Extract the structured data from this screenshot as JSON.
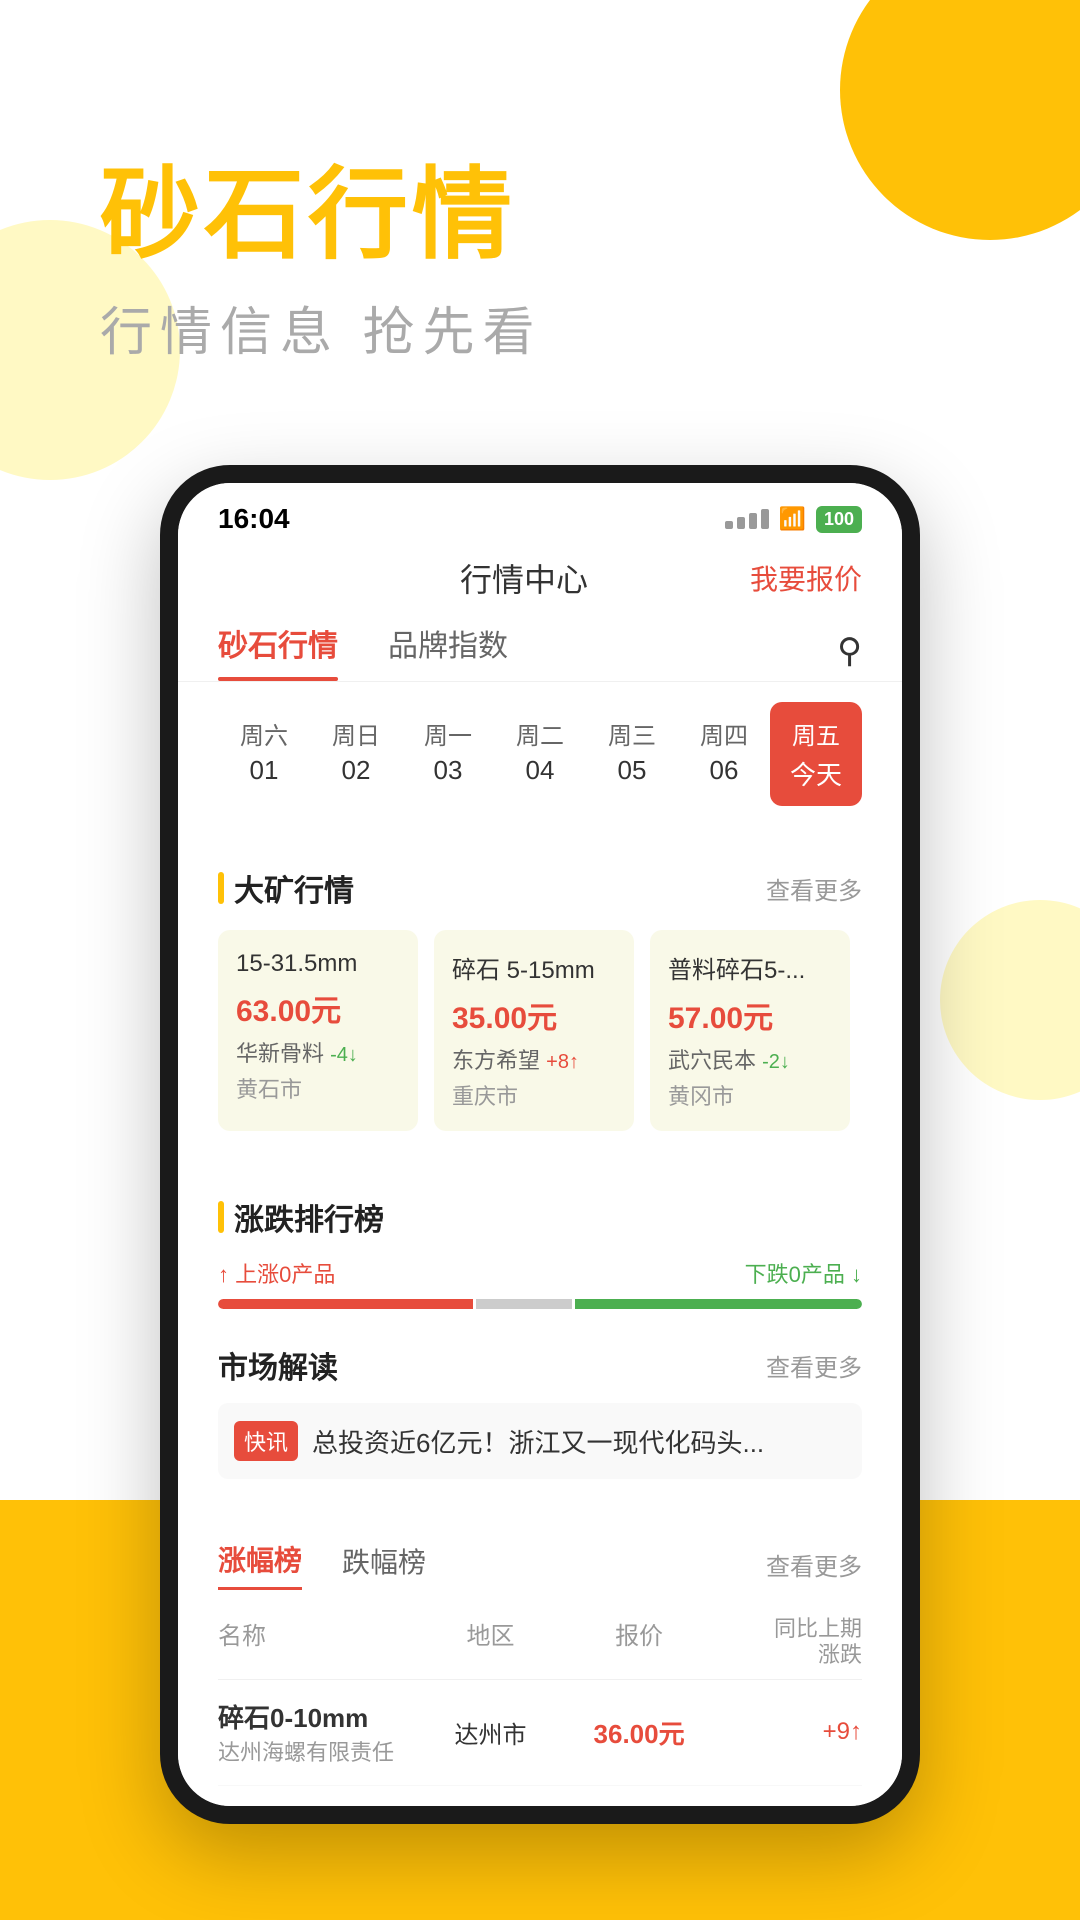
{
  "app": {
    "title": "砂石行情",
    "subtitle": "行情信息  抢先看"
  },
  "status_bar": {
    "time": "16:04",
    "battery": "100"
  },
  "header": {
    "title": "行情中心",
    "action": "我要报价"
  },
  "tabs": [
    {
      "label": "砂石行情",
      "active": true
    },
    {
      "label": "品牌指数",
      "active": false
    }
  ],
  "days": [
    {
      "name": "周六",
      "num": "01",
      "active": false
    },
    {
      "name": "周日",
      "num": "02",
      "active": false
    },
    {
      "name": "周一",
      "num": "03",
      "active": false
    },
    {
      "name": "周二",
      "num": "04",
      "active": false
    },
    {
      "name": "周三",
      "num": "05",
      "active": false
    },
    {
      "name": "周四",
      "num": "06",
      "active": false
    },
    {
      "name": "周五",
      "num": "今天",
      "active": true
    }
  ],
  "market_section": {
    "title": "大矿行情",
    "more": "查看更多",
    "cards": [
      {
        "product": "15-31.5mm",
        "price": "63.00元",
        "company": "华新骨料",
        "change": "-4↓",
        "change_type": "down",
        "city": "黄石市"
      },
      {
        "product": "碎石 5-15mm",
        "price": "35.00元",
        "company": "东方希望",
        "change": "+8↑",
        "change_type": "up",
        "city": "重庆市"
      },
      {
        "product": "普料碎石5-...",
        "price": "57.00元",
        "company": "武穴民本",
        "change": "-2↓",
        "change_type": "down",
        "city": "黄冈市"
      }
    ]
  },
  "rise_fall_section": {
    "title": "涨跌排行榜",
    "rise_label": "↑ 上涨0产品",
    "fall_label": "下跌0产品 ↓",
    "bar_rise_pct": 40,
    "bar_neutral_pct": 15,
    "bar_fall_pct": 45
  },
  "insight_section": {
    "title": "市场解读",
    "more": "查看更多",
    "badge": "快讯",
    "text": "总投资近6亿元！浙江又一现代化码头..."
  },
  "rank_section": {
    "title_rise": "涨幅榜",
    "title_fall": "跌幅榜",
    "more": "查看更多",
    "columns": [
      "名称",
      "地区",
      "报价",
      "同比上期\n涨跌"
    ],
    "rows": [
      {
        "name": "碎石0-10mm",
        "company": "达州海螺有限责任",
        "region": "达州市",
        "price": "36.00元",
        "change": "+9↑",
        "change_type": "up"
      }
    ]
  }
}
